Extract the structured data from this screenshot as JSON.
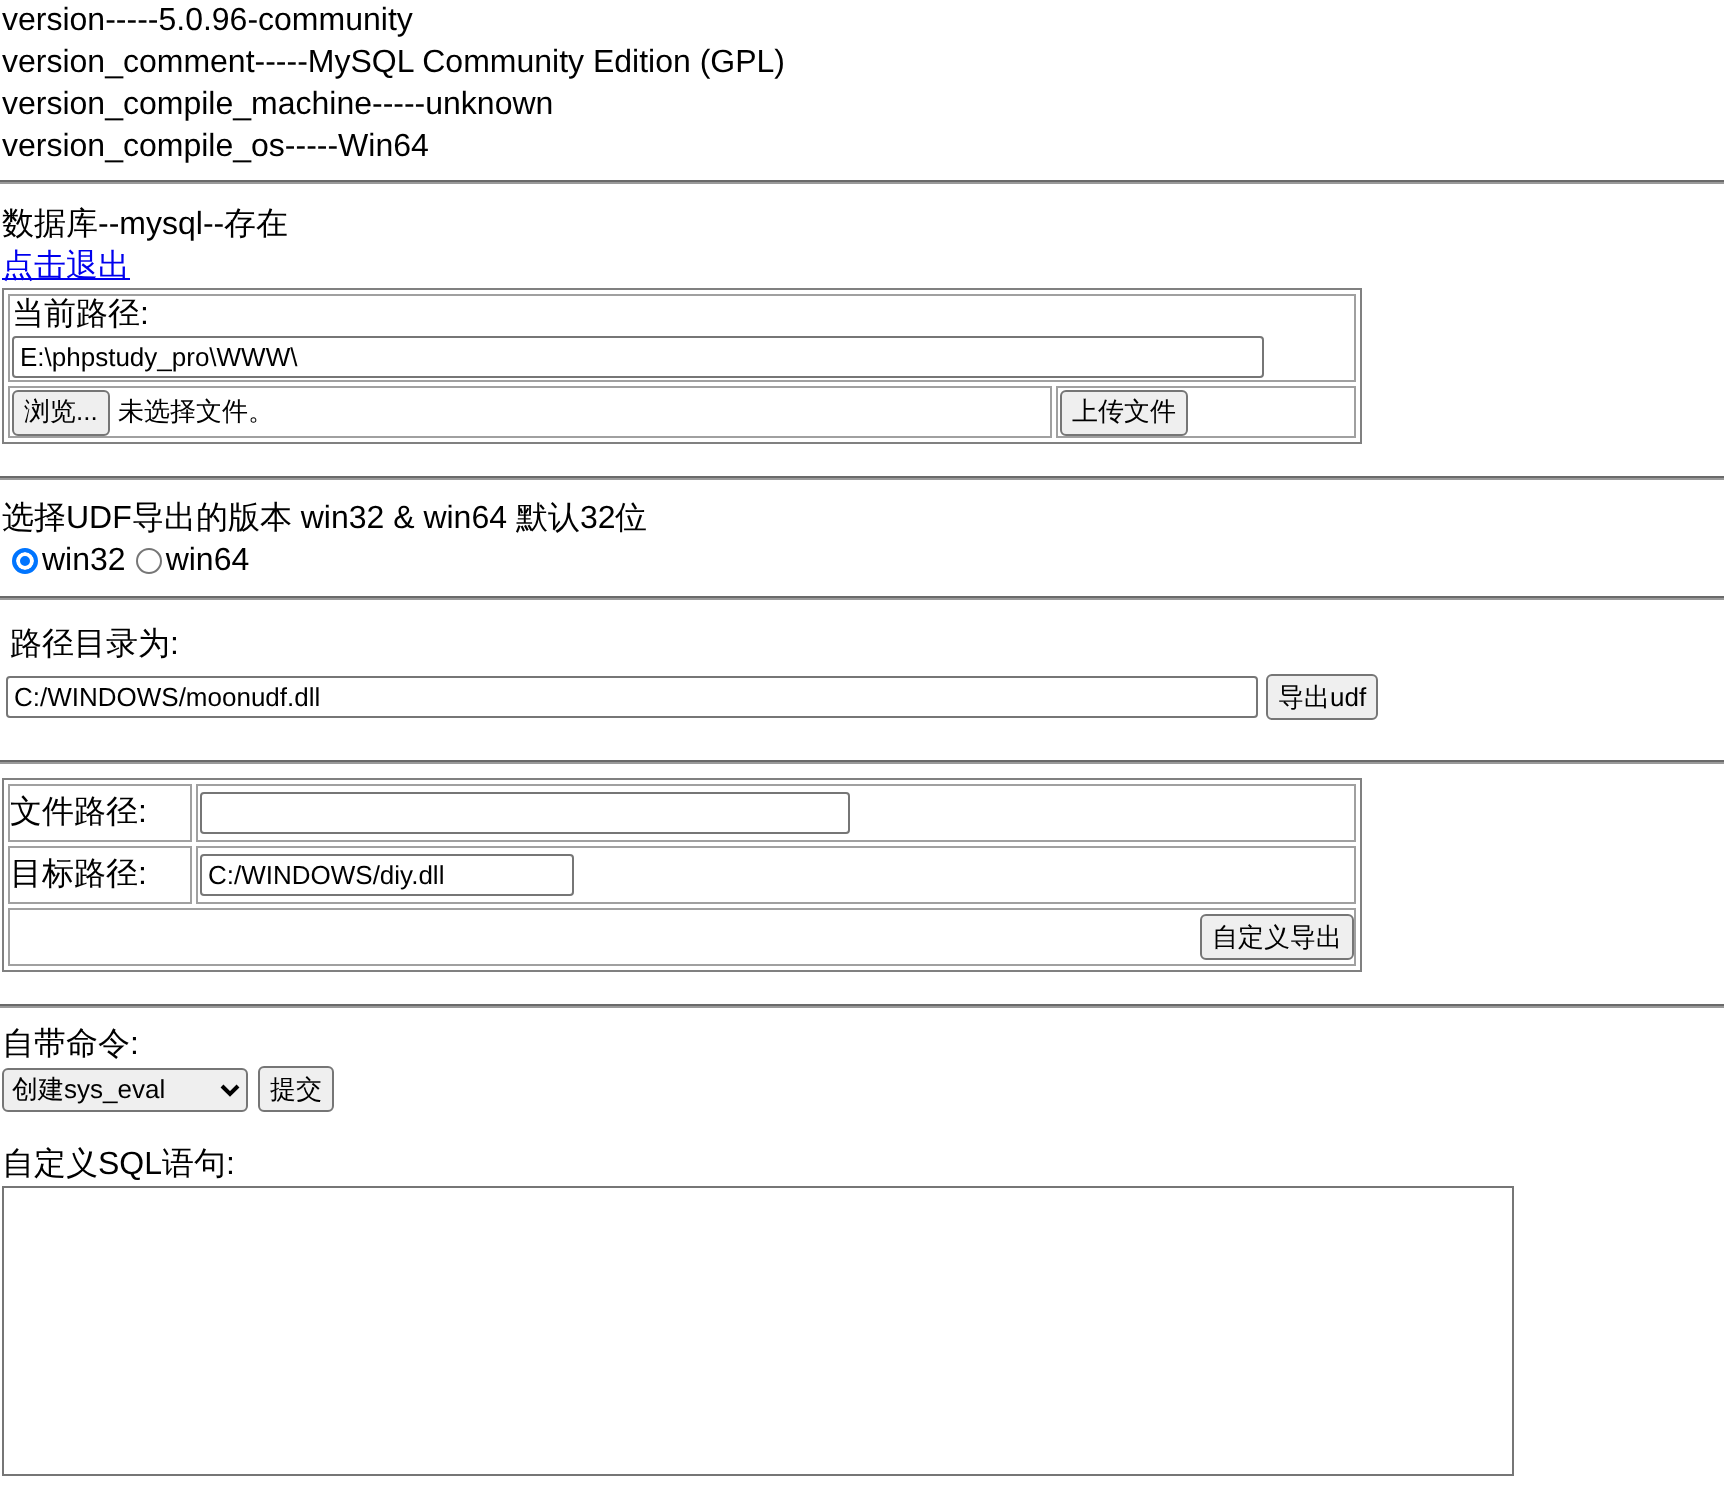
{
  "server_info": [
    "version-----5.0.96-community",
    "version_comment-----MySQL Community Edition (GPL)",
    "version_compile_machine-----unknown",
    "version_compile_os-----Win64"
  ],
  "database_status": "数据库--mysql--存在",
  "logout_link": "点击退出",
  "upload": {
    "path_label": "当前路径:",
    "path_value": "E:\\phpstudy_pro\\WWW\\",
    "browse_button": "浏览...",
    "file_status": "未选择文件。",
    "upload_button": "上传文件"
  },
  "udf_version": {
    "label": "选择UDF导出的版本 win32 & win64 默认32位",
    "options": [
      {
        "label": "win32",
        "selected": true
      },
      {
        "label": "win64",
        "selected": false
      }
    ]
  },
  "export_udf": {
    "label": "路径目录为:",
    "path_value": "C:/WINDOWS/moonudf.dll",
    "button": "导出udf"
  },
  "custom_export": {
    "fields": [
      {
        "label": "文件路径:"
      },
      {
        "label": "目标路径:",
        "value": "C:/WINDOWS/diy.dll"
      }
    ],
    "button": "自定义导出"
  },
  "builtin_command": {
    "label": "自带命令:",
    "selected_option": "创建sys_eval",
    "button": "提交"
  },
  "custom_sql": {
    "label": "自定义SQL语句:"
  }
}
